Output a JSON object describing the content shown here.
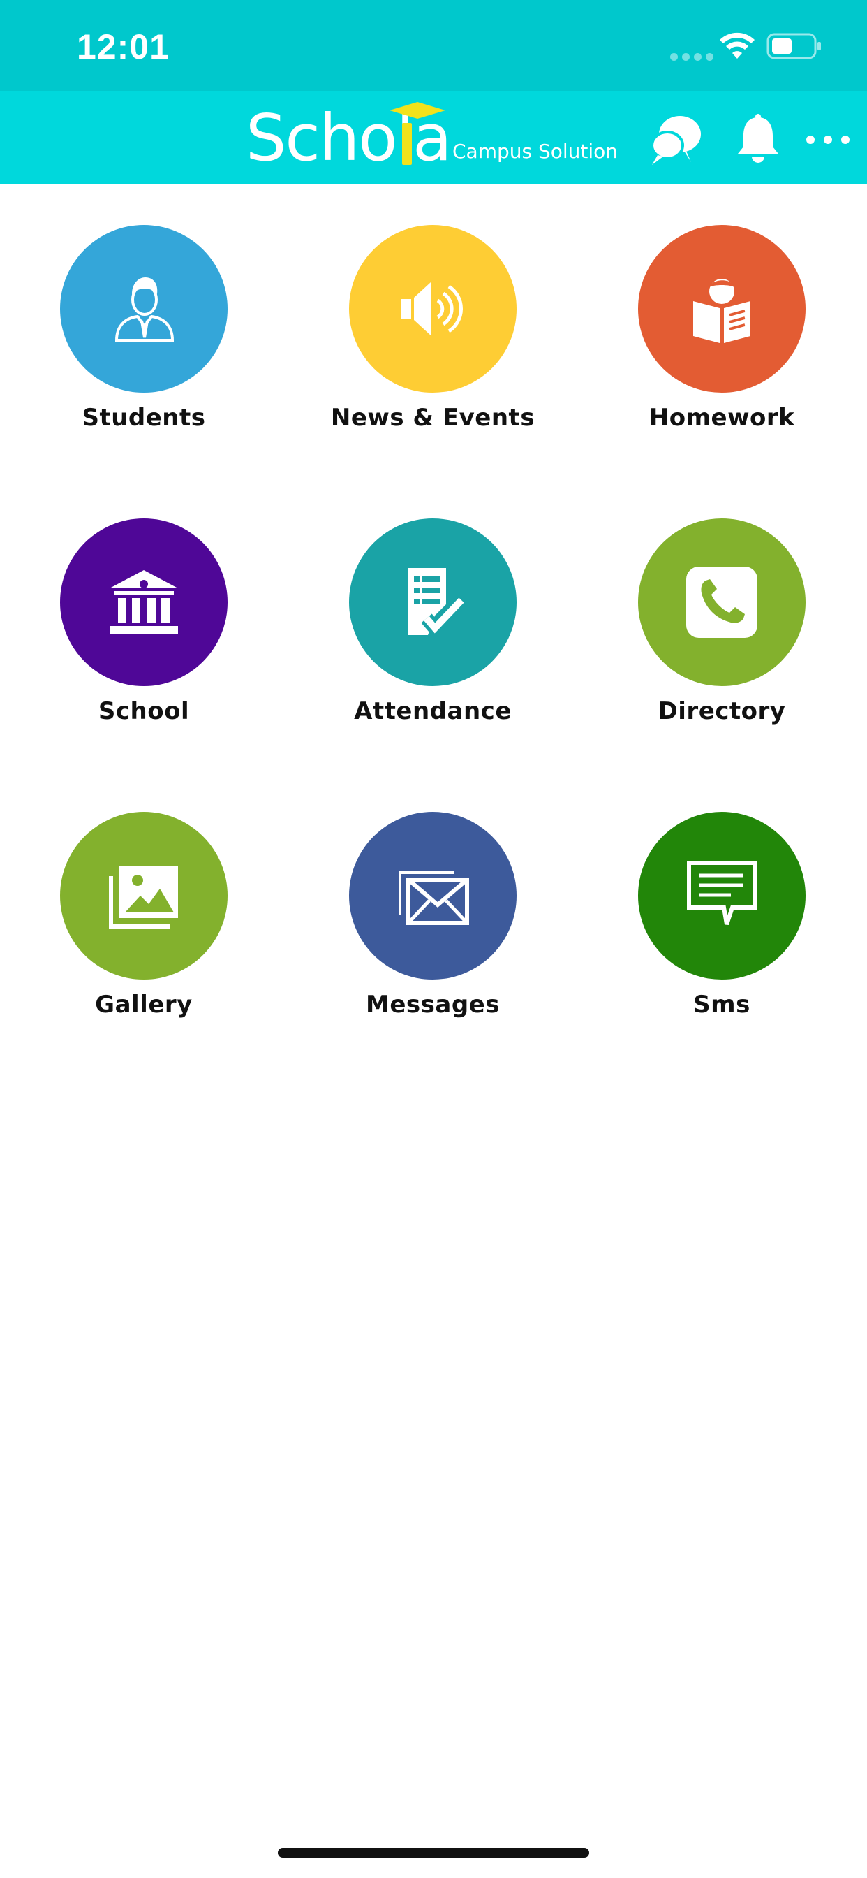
{
  "status_bar": {
    "time": "12:01",
    "background": "#00c8cc"
  },
  "header": {
    "logo_text": "Schola",
    "logo_subtitle": "Campus Solution",
    "background": "#00d8dc",
    "icons": [
      "chat-icon",
      "bell-icon",
      "more-icon"
    ]
  },
  "menu": {
    "items": [
      {
        "label": "Students",
        "color": "#34a6d9",
        "icon": "student-icon"
      },
      {
        "label": "News & Events",
        "color": "#fecd34",
        "icon": "speaker-icon"
      },
      {
        "label": "Homework",
        "color": "#e35c33",
        "icon": "reading-book-icon"
      },
      {
        "label": "School",
        "color": "#4f0797",
        "icon": "school-building-icon"
      },
      {
        "label": "Attendance",
        "color": "#1aa3a6",
        "icon": "checklist-icon"
      },
      {
        "label": "Directory",
        "color": "#83b12d",
        "icon": "phone-icon"
      },
      {
        "label": "Gallery",
        "color": "#83b12d",
        "icon": "gallery-icon"
      },
      {
        "label": "Messages",
        "color": "#3d5a9b",
        "icon": "envelope-icon"
      },
      {
        "label": "Sms",
        "color": "#228609",
        "icon": "sms-bubble-icon"
      }
    ]
  }
}
